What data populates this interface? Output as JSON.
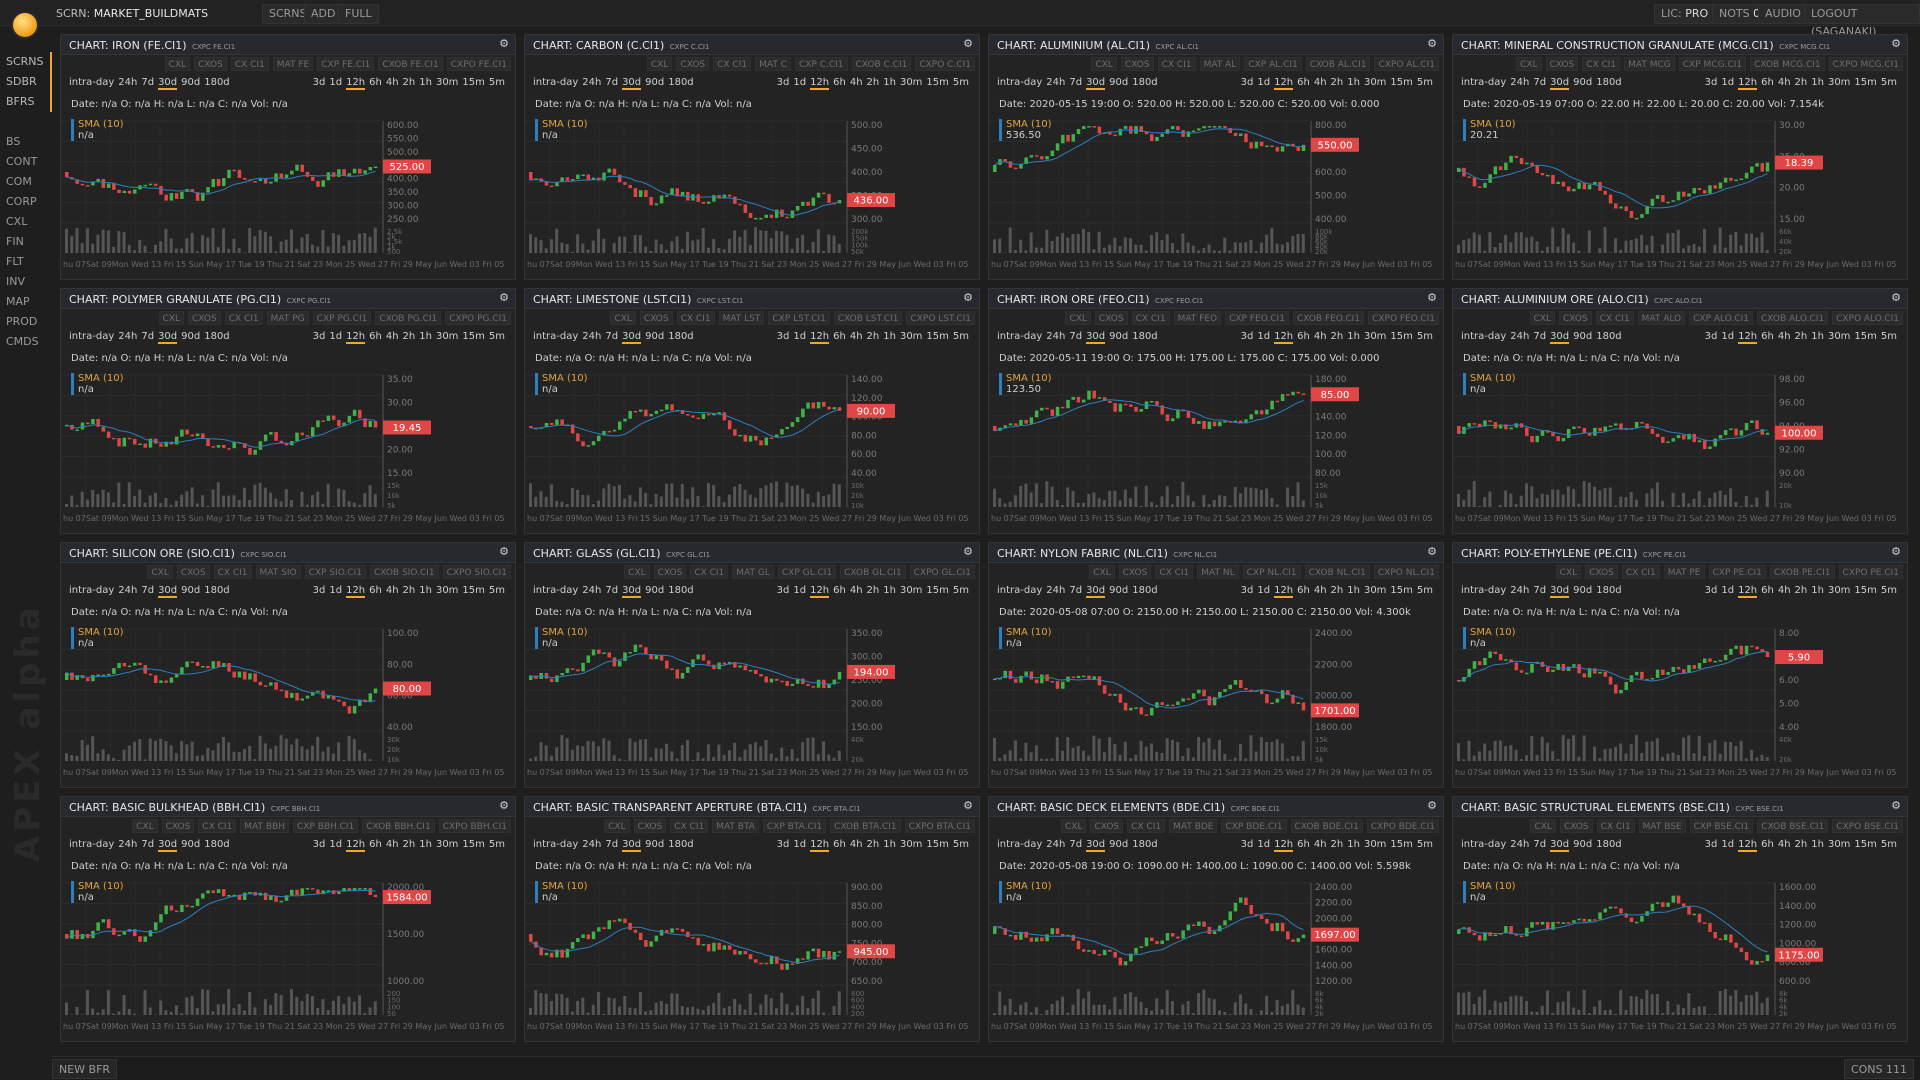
{
  "topbar": {
    "screen_prefix": "SCRN:",
    "screen_name": "MARKET_BUILDMATS",
    "buttons": [
      "SCRNS",
      "ADD",
      "FULL"
    ],
    "lic_label": "LIC:",
    "lic_value": "PRO",
    "nots_label": "NOTS",
    "nots_value": "0",
    "audio": "AUDIO",
    "logout": "LOGOUT (SAGANAKI)"
  },
  "sidebar": {
    "items_top": [
      "SCRNS",
      "SDBR",
      "BFRS"
    ],
    "items": [
      "BS",
      "CONT",
      "COM",
      "CORP",
      "CXL",
      "FIN",
      "FLT",
      "INV",
      "MAP",
      "PROD",
      "CMDS"
    ],
    "brand": "APEX alpha"
  },
  "bottombar": {
    "new_bfr": "NEW BFR",
    "cons": "CONS 111"
  },
  "colors": {
    "accent": "#f5a623",
    "up": "#3fb24a",
    "down": "#e04646",
    "sma": "#2e7fbf"
  },
  "common": {
    "cmds": [
      "CXL",
      "CXOS",
      "CX CI1",
      "MAT",
      "CXP",
      "CXOB",
      "CXPO"
    ],
    "ranges_left": [
      "intra-day",
      "24h",
      "7d",
      "30d",
      "90d",
      "180d"
    ],
    "ranges_right": [
      "3d",
      "1d",
      "12h",
      "6h",
      "4h",
      "2h",
      "1h",
      "30m",
      "15m",
      "5m"
    ],
    "sma_label": "SMA (10)",
    "x_labels": [
      "hu 07Sat 09Mon",
      "Wed 13",
      "Fri 15",
      "Sun",
      "May 17",
      "Tue 19",
      "Thu 21",
      "Sat 23",
      "Mon 25",
      "Wed 27",
      "Fri 29",
      "May",
      "Jun",
      "Wed 03",
      "Fri 05"
    ]
  },
  "charts": [
    {
      "title": "CHART: IRON (FE.CI1)",
      "sub": "CXPC FE.CI1",
      "ticker": "FE.CI1",
      "info": "Date: n/a O: n/a H: n/a L: n/a C: n/a Vol: n/a",
      "sma_value": "n/a",
      "price": "525.00",
      "y_ticks": [
        "600.00",
        "550.00",
        "500.00",
        "450.00",
        "400.00",
        "350.00",
        "300.00",
        "250.00"
      ],
      "vol_ticks": [
        "2.5k",
        "2k",
        "1.5k",
        "1k",
        "500"
      ]
    },
    {
      "title": "CHART: CARBON (C.CI1)",
      "sub": "CXPC C.CI1",
      "ticker": "C.CI1",
      "info": "Date: n/a O: n/a H: n/a L: n/a C: n/a Vol: n/a",
      "sma_value": "n/a",
      "price": "436.00",
      "y_ticks": [
        "500.00",
        "450.00",
        "400.00",
        "350.00",
        "300.00"
      ],
      "vol_ticks": [
        "200k",
        "150k",
        "100k",
        "50k"
      ]
    },
    {
      "title": "CHART: ALUMINIUM (AL.CI1)",
      "sub": "CXPC AL.CI1",
      "ticker": "AL.CI1",
      "info": "Date: 2020-05-15 19:00 O: 520.00 H: 520.00 L: 520.00 C: 520.00 Vol: 0.000",
      "sma_value": "536.50",
      "price": "550.00",
      "y_ticks": [
        "800.00",
        "700.00",
        "600.00",
        "500.00",
        "400.00"
      ],
      "vol_ticks": [
        "100k",
        "80k",
        "60k",
        "40k",
        "20k"
      ]
    },
    {
      "title": "CHART: MINERAL CONSTRUCTION GRANULATE (MCG.CI1)",
      "sub": "CXPC MCG.CI1",
      "ticker": "MCG.CI1",
      "info": "Date: 2020-05-19 07:00 O: 22.00 H: 22.00 L: 20.00 C: 20.00 Vol: 7.154k",
      "sma_value": "20.21",
      "price": "18.39",
      "y_ticks": [
        "30.00",
        "25.00",
        "20.00",
        "15.00"
      ],
      "vol_ticks": [
        "60k",
        "40k",
        "20k"
      ]
    },
    {
      "title": "CHART: POLYMER GRANULATE (PG.CI1)",
      "sub": "CXPC PG.CI1",
      "ticker": "PG.CI1",
      "info": "Date: n/a O: n/a H: n/a L: n/a C: n/a Vol: n/a",
      "sma_value": "n/a",
      "price": "19.45",
      "y_ticks": [
        "35.00",
        "30.00",
        "25.00",
        "20.00",
        "15.00"
      ],
      "vol_ticks": [
        "15k",
        "10k",
        "5k"
      ]
    },
    {
      "title": "CHART: LIMESTONE (LST.CI1)",
      "sub": "CXPC LST.CI1",
      "ticker": "LST.CI1",
      "info": "Date: n/a O: n/a H: n/a L: n/a C: n/a Vol: n/a",
      "sma_value": "n/a",
      "price": "90.00",
      "y_ticks": [
        "140.00",
        "120.00",
        "100.00",
        "80.00",
        "60.00",
        "40.00"
      ],
      "vol_ticks": [
        "30k",
        "20k",
        "10k"
      ]
    },
    {
      "title": "CHART: IRON ORE (FEO.CI1)",
      "sub": "CXPC FEO.CI1",
      "ticker": "FEO.CI1",
      "info": "Date: 2020-05-11 19:00 O: 175.00 H: 175.00 L: 175.00 C: 175.00 Vol: 0.000",
      "sma_value": "123.50",
      "price": "85.00",
      "y_ticks": [
        "180.00",
        "160.00",
        "140.00",
        "120.00",
        "100.00",
        "80.00"
      ],
      "vol_ticks": [
        "15k",
        "10k",
        "5k"
      ]
    },
    {
      "title": "CHART: ALUMINIUM ORE (ALO.CI1)",
      "sub": "CXPC ALO.CI1",
      "ticker": "ALO.CI1",
      "info": "Date: n/a O: n/a H: n/a L: n/a C: n/a Vol: n/a",
      "sma_value": "n/a",
      "price": "100.00",
      "y_ticks": [
        "98.00",
        "96.00",
        "94.00",
        "92.00",
        "90.00"
      ],
      "vol_ticks": [
        "20k",
        "10k"
      ]
    },
    {
      "title": "CHART: SILICON ORE (SIO.CI1)",
      "sub": "CXPC SIO.CI1",
      "ticker": "SIO.CI1",
      "info": "Date: n/a O: n/a H: n/a L: n/a C: n/a Vol: n/a",
      "sma_value": "n/a",
      "price": "80.00",
      "y_ticks": [
        "100.00",
        "80.00",
        "60.00",
        "40.00"
      ],
      "vol_ticks": [
        "30k",
        "20k",
        "10k"
      ]
    },
    {
      "title": "CHART: GLASS (GL.CI1)",
      "sub": "CXPC GL.CI1",
      "ticker": "GL.CI1",
      "info": "Date: n/a O: n/a H: n/a L: n/a C: n/a Vol: n/a",
      "sma_value": "n/a",
      "price": "194.00",
      "y_ticks": [
        "350.00",
        "300.00",
        "250.00",
        "200.00",
        "150.00"
      ],
      "vol_ticks": [
        "40k",
        "20k"
      ]
    },
    {
      "title": "CHART: NYLON FABRIC (NL.CI1)",
      "sub": "CXPC NL.CI1",
      "ticker": "NL.CI1",
      "info": "Date: 2020-05-08 07:00 O: 2150.00 H: 2150.00 L: 2150.00 C: 2150.00 Vol: 4.300k",
      "sma_value": "n/a",
      "price": "1701.00",
      "y_ticks": [
        "2400.00",
        "2200.00",
        "2000.00",
        "1800.00"
      ],
      "vol_ticks": [
        "15k",
        "10k",
        "5k"
      ]
    },
    {
      "title": "CHART: POLY-ETHYLENE (PE.CI1)",
      "sub": "CXPC PE.CI1",
      "ticker": "PE.CI1",
      "info": "Date: n/a O: n/a H: n/a L: n/a C: n/a Vol: n/a",
      "sma_value": "n/a",
      "price": "5.90",
      "y_ticks": [
        "8.00",
        "7.00",
        "6.00",
        "5.00",
        "4.00"
      ],
      "vol_ticks": [
        "40k",
        "20k"
      ]
    },
    {
      "title": "CHART: BASIC BULKHEAD (BBH.CI1)",
      "sub": "CXPC BBH.CI1",
      "ticker": "BBH.CI1",
      "info": "Date: n/a O: n/a H: n/a L: n/a C: n/a Vol: n/a",
      "sma_value": "n/a",
      "price": "1584.00",
      "y_ticks": [
        "2000.00",
        "1500.00",
        "1000.00"
      ],
      "vol_ticks": [
        "200",
        "150",
        "100",
        "50"
      ]
    },
    {
      "title": "CHART: BASIC TRANSPARENT APERTURE (BTA.CI1)",
      "sub": "CXPC BTA.CI1",
      "ticker": "BTA.CI1",
      "info": "Date: n/a O: n/a H: n/a L: n/a C: n/a Vol: n/a",
      "sma_value": "n/a",
      "price": "945.00",
      "y_ticks": [
        "900.00",
        "850.00",
        "800.00",
        "750.00",
        "700.00",
        "650.00"
      ],
      "vol_ticks": [
        "800",
        "600",
        "400",
        "200"
      ]
    },
    {
      "title": "CHART: BASIC DECK ELEMENTS (BDE.CI1)",
      "sub": "CXPC BDE.CI1",
      "ticker": "BDE.CI1",
      "info": "Date: 2020-05-08 19:00 O: 1090.00 H: 1400.00 L: 1090.00 C: 1400.00 Vol: 5.598k",
      "sma_value": "n/a",
      "price": "1697.00",
      "y_ticks": [
        "2400.00",
        "2200.00",
        "2000.00",
        "1800.00",
        "1600.00",
        "1400.00",
        "1200.00"
      ],
      "vol_ticks": [
        "8k",
        "6k",
        "4k",
        "2k"
      ]
    },
    {
      "title": "CHART: BASIC STRUCTURAL ELEMENTS (BSE.CI1)",
      "sub": "CXPC BSE.CI1",
      "ticker": "BSE.CI1",
      "info": "Date: n/a O: n/a H: n/a L: n/a C: n/a Vol: n/a",
      "sma_value": "n/a",
      "price": "1175.00",
      "y_ticks": [
        "1600.00",
        "1400.00",
        "1200.00",
        "1000.00",
        "800.00",
        "600.00"
      ],
      "vol_ticks": [
        "8k",
        "6k",
        "4k",
        "2k"
      ]
    }
  ]
}
